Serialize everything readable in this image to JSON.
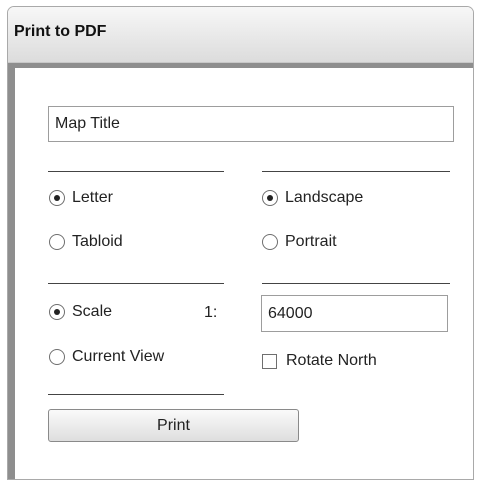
{
  "dialog": {
    "title": "Print to PDF"
  },
  "map_title": {
    "value": "Map Title"
  },
  "page_size": {
    "options": [
      {
        "label": "Letter",
        "selected": true
      },
      {
        "label": "Tabloid",
        "selected": false
      }
    ]
  },
  "orientation": {
    "options": [
      {
        "label": "Landscape",
        "selected": true
      },
      {
        "label": "Portrait",
        "selected": false
      }
    ]
  },
  "extent": {
    "options": [
      {
        "label": "Scale",
        "selected": true
      },
      {
        "label": "Current View",
        "selected": false
      }
    ],
    "scale_prefix": "1:",
    "scale_value": "64000"
  },
  "rotate_north": {
    "label": "Rotate North",
    "checked": false
  },
  "print_button": {
    "label": "Print"
  }
}
